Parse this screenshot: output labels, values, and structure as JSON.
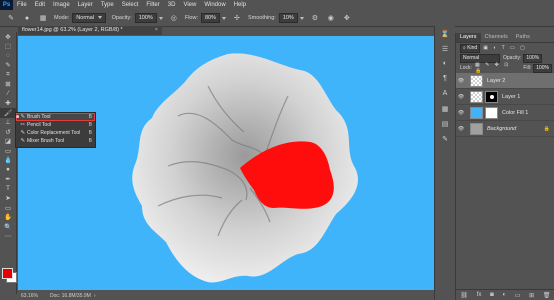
{
  "app": {
    "logo": "Ps"
  },
  "menu": [
    "File",
    "Edit",
    "Image",
    "Layer",
    "Type",
    "Select",
    "Filter",
    "3D",
    "View",
    "Window",
    "Help"
  ],
  "options": {
    "mode_label": "Mode:",
    "mode_value": "Normal",
    "opacity_label": "Opacity:",
    "opacity_value": "100%",
    "flow_label": "Flow:",
    "flow_value": "80%",
    "smoothing_label": "Smoothing:",
    "smoothing_value": "10%"
  },
  "document": {
    "tab_title": "flower14.jpg @ 63.2% (Layer 2, RGB/8) *",
    "close": "×"
  },
  "status": {
    "zoom": "63.16%",
    "doc_size": "Doc: 16.8M/35.9M"
  },
  "flyout": [
    {
      "label": "Brush Tool",
      "shortcut": "B",
      "icon": "brush-icon",
      "selected": true
    },
    {
      "label": "Pencil Tool",
      "shortcut": "B",
      "icon": "pencil-icon",
      "selected": false
    },
    {
      "label": "Color Replacement Tool",
      "shortcut": "B",
      "icon": "color-replacement-icon",
      "selected": false
    },
    {
      "label": "Mixer Brush Tool",
      "shortcut": "B",
      "icon": "mixer-brush-icon",
      "selected": false
    }
  ],
  "layers_panel": {
    "tabs": [
      "Layers",
      "Channels",
      "Paths"
    ],
    "kind_label": "Kind",
    "blend_mode": "Normal",
    "opacity_label": "Opacity:",
    "opacity_value": "100%",
    "lock_label": "Lock:",
    "fill_label": "Fill:",
    "fill_value": "100%",
    "layers": [
      {
        "name": "Layer 2",
        "selected": true
      },
      {
        "name": "Layer 1",
        "selected": false
      },
      {
        "name": "Color Fill 1",
        "selected": false
      },
      {
        "name": "Background",
        "selected": false
      }
    ]
  },
  "colors": {
    "canvas": "#3fb4fb",
    "foreground": "#e60000",
    "background": "#ffffff",
    "accent": "#31a8ff"
  }
}
